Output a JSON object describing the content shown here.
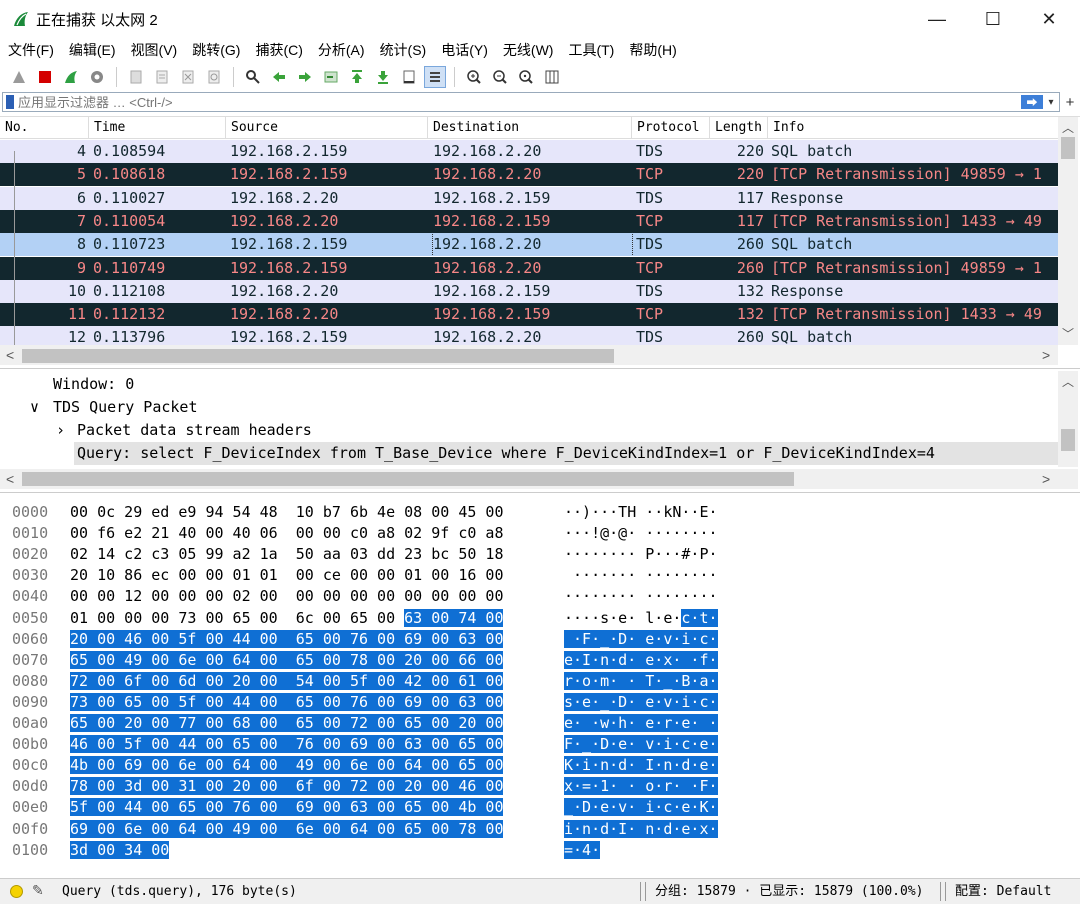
{
  "window": {
    "title": "正在捕获 以太网 2",
    "minimize": "—",
    "maximize": "☐",
    "close": "✕"
  },
  "menu": [
    "文件(F)",
    "编辑(E)",
    "视图(V)",
    "跳转(G)",
    "捕获(C)",
    "分析(A)",
    "统计(S)",
    "电话(Y)",
    "无线(W)",
    "工具(T)",
    "帮助(H)"
  ],
  "filter": {
    "placeholder": "应用显示过滤器 … <Ctrl-/>",
    "apply": "⮕",
    "dropdown": "▾",
    "add": "+"
  },
  "packet_list": {
    "columns": [
      "No.",
      "Time",
      "Source",
      "Destination",
      "Protocol",
      "Length",
      "Info"
    ],
    "rows": [
      {
        "no": "4",
        "time": "0.108594",
        "src": "192.168.2.159",
        "dst": "192.168.2.20",
        "proto": "TDS",
        "len": "220",
        "info": "SQL batch",
        "style": "tds"
      },
      {
        "no": "5",
        "time": "0.108618",
        "src": "192.168.2.159",
        "dst": "192.168.2.20",
        "proto": "TCP",
        "len": "220",
        "info": "[TCP Retransmission] 49859 → 1",
        "style": "tcp"
      },
      {
        "no": "6",
        "time": "0.110027",
        "src": "192.168.2.20",
        "dst": "192.168.2.159",
        "proto": "TDS",
        "len": "117",
        "info": "Response",
        "style": "tds"
      },
      {
        "no": "7",
        "time": "0.110054",
        "src": "192.168.2.20",
        "dst": "192.168.2.159",
        "proto": "TCP",
        "len": "117",
        "info": "[TCP Retransmission] 1433 → 49",
        "style": "tcp"
      },
      {
        "no": "8",
        "time": "0.110723",
        "src": "192.168.2.159",
        "dst": "192.168.2.20",
        "proto": "TDS",
        "len": "260",
        "info": "SQL batch",
        "style": "sel"
      },
      {
        "no": "9",
        "time": "0.110749",
        "src": "192.168.2.159",
        "dst": "192.168.2.20",
        "proto": "TCP",
        "len": "260",
        "info": "[TCP Retransmission] 49859 → 1",
        "style": "tcp"
      },
      {
        "no": "10",
        "time": "0.112108",
        "src": "192.168.2.20",
        "dst": "192.168.2.159",
        "proto": "TDS",
        "len": "132",
        "info": "Response",
        "style": "tds"
      },
      {
        "no": "11",
        "time": "0.112132",
        "src": "192.168.2.20",
        "dst": "192.168.2.159",
        "proto": "TCP",
        "len": "132",
        "info": "[TCP Retransmission] 1433 → 49",
        "style": "tcp"
      },
      {
        "no": "12",
        "time": "0.113796",
        "src": "192.168.2.159",
        "dst": "192.168.2.20",
        "proto": "TDS",
        "len": "260",
        "info": "SQL batch",
        "style": "tds"
      }
    ]
  },
  "details": {
    "window": "Window: 0",
    "tds_query": "TDS Query Packet",
    "stream_headers": "Packet data stream headers",
    "query": "Query: select F_DeviceIndex from T_Base_Device where F_DeviceKindIndex=1 or F_DeviceKindIndex=4",
    "expanded_arrow": "∨",
    "collapsed_arrow": "›"
  },
  "bytes": [
    {
      "off": "0000",
      "hex": "00 0c 29 ed e9 94 54 48  10 b7 6b 4e 08 00 45 00",
      "asc": "··)···TH ··kN··E·",
      "hl_hex": 0,
      "hl_asc": 0
    },
    {
      "off": "0010",
      "hex": "00 f6 e2 21 40 00 40 06  00 00 c0 a8 02 9f c0 a8",
      "asc": "···!@·@· ········",
      "hl_hex": 0,
      "hl_asc": 0
    },
    {
      "off": "0020",
      "hex": "02 14 c2 c3 05 99 a2 1a  50 aa 03 dd 23 bc 50 18",
      "asc": "········ P···#·P·",
      "hl_hex": 0,
      "hl_asc": 0
    },
    {
      "off": "0030",
      "hex": "20 10 86 ec 00 00 01 01  00 ce 00 00 01 00 16 00",
      "asc": " ······· ········",
      "hl_hex": 0,
      "hl_asc": 0
    },
    {
      "off": "0040",
      "hex": "00 00 12 00 00 00 02 00  00 00 00 00 00 00 00 00",
      "asc": "········ ········",
      "hl_hex": 0,
      "hl_asc": 0
    },
    {
      "off": "0050",
      "hex": "01 00 00 00 73 00 65 00  6c 00 65 00 63 00 74 00",
      "asc": "····s·e· l·e·c·t·",
      "hl_hex": 4,
      "hl_asc": 4
    },
    {
      "off": "0060",
      "hex": "20 00 46 00 5f 00 44 00  65 00 76 00 69 00 63 00",
      "asc": " ·F·_·D· e·v·i·c·",
      "hl_hex": 16,
      "hl_asc": 16
    },
    {
      "off": "0070",
      "hex": "65 00 49 00 6e 00 64 00  65 00 78 00 20 00 66 00",
      "asc": "e·I·n·d· e·x· ·f·",
      "hl_hex": 16,
      "hl_asc": 16
    },
    {
      "off": "0080",
      "hex": "72 00 6f 00 6d 00 20 00  54 00 5f 00 42 00 61 00",
      "asc": "r·o·m· · T·_·B·a·",
      "hl_hex": 16,
      "hl_asc": 16
    },
    {
      "off": "0090",
      "hex": "73 00 65 00 5f 00 44 00  65 00 76 00 69 00 63 00",
      "asc": "s·e·_·D· e·v·i·c·",
      "hl_hex": 16,
      "hl_asc": 16
    },
    {
      "off": "00a0",
      "hex": "65 00 20 00 77 00 68 00  65 00 72 00 65 00 20 00",
      "asc": "e· ·w·h· e·r·e· ·",
      "hl_hex": 16,
      "hl_asc": 16
    },
    {
      "off": "00b0",
      "hex": "46 00 5f 00 44 00 65 00  76 00 69 00 63 00 65 00",
      "asc": "F·_·D·e· v·i·c·e·",
      "hl_hex": 16,
      "hl_asc": 16
    },
    {
      "off": "00c0",
      "hex": "4b 00 69 00 6e 00 64 00  49 00 6e 00 64 00 65 00",
      "asc": "K·i·n·d· I·n·d·e·",
      "hl_hex": 16,
      "hl_asc": 16
    },
    {
      "off": "00d0",
      "hex": "78 00 3d 00 31 00 20 00  6f 00 72 00 20 00 46 00",
      "asc": "x·=·1· · o·r· ·F·",
      "hl_hex": 16,
      "hl_asc": 16
    },
    {
      "off": "00e0",
      "hex": "5f 00 44 00 65 00 76 00  69 00 63 00 65 00 4b 00",
      "asc": "_·D·e·v· i·c·e·K·",
      "hl_hex": 16,
      "hl_asc": 16
    },
    {
      "off": "00f0",
      "hex": "69 00 6e 00 64 00 49 00  6e 00 64 00 65 00 78 00",
      "asc": "i·n·d·I· n·d·e·x·",
      "hl_hex": 16,
      "hl_asc": 16
    },
    {
      "off": "0100",
      "hex": "3d 00 34 00",
      "asc": "=·4·",
      "hl_hex": 4,
      "hl_asc": 4
    }
  ],
  "status": {
    "field": "Query (tds.query), 176 byte(s)",
    "packets": "分组: 15879 · 已显示: 15879 (100.0%)",
    "profile": "配置: Default"
  },
  "colors": {
    "tds_bg": "#e6e6fa",
    "tcp_bg": "#12272e",
    "tcp_fg": "#f78787",
    "selected_bg": "#b3d1f5",
    "byte_highlight": "#0f6fd4"
  }
}
